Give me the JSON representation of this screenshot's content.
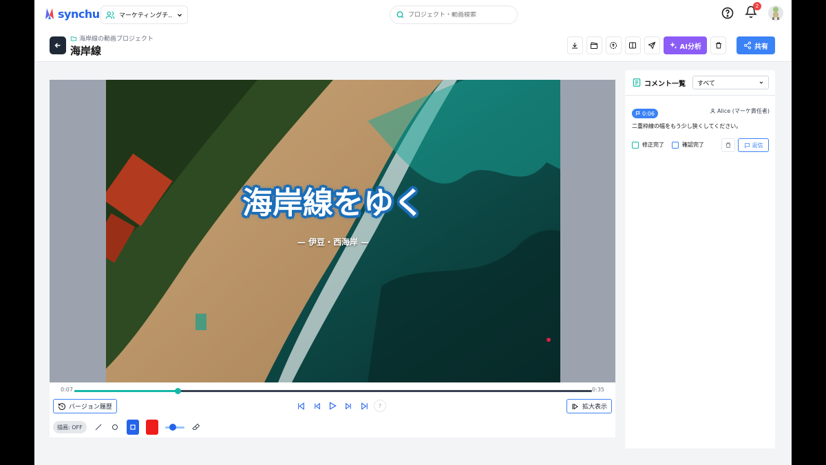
{
  "app": {
    "logo_text": "synchub",
    "brand_color": "#2563eb"
  },
  "topbar": {
    "team_label": "マーケティングチ…",
    "search_placeholder": "プロジェクト・動画検索",
    "notification_count": "2"
  },
  "header": {
    "breadcrumb": "海岸線の動画プロジェクト",
    "title": "海岸線",
    "ai_label": "AI分析",
    "share_label": "共有"
  },
  "video": {
    "title_overlay": "海岸線をゆく",
    "subtitle_overlay": "— 伊豆・西海岸 —",
    "current_time": "0:07",
    "duration": "0:35",
    "progress_fraction": 0.2
  },
  "controls": {
    "version_history_label": "バージョン履歴",
    "expand_label": "拡大表示",
    "help_label": "?",
    "draw_toggle_label": "描画: OFF",
    "draw_color": "#ef1c1c"
  },
  "comments": {
    "panel_title": "コメント一覧",
    "filter_value": "すべて",
    "items": [
      {
        "timestamp": "0:06",
        "author": "Alice (マーケ責任者)",
        "text": "二重枠線の幅をもう少し狭くしてください。",
        "fix_done_label": "修正完了",
        "confirm_done_label": "確認完了",
        "reply_label": "返信"
      }
    ]
  }
}
